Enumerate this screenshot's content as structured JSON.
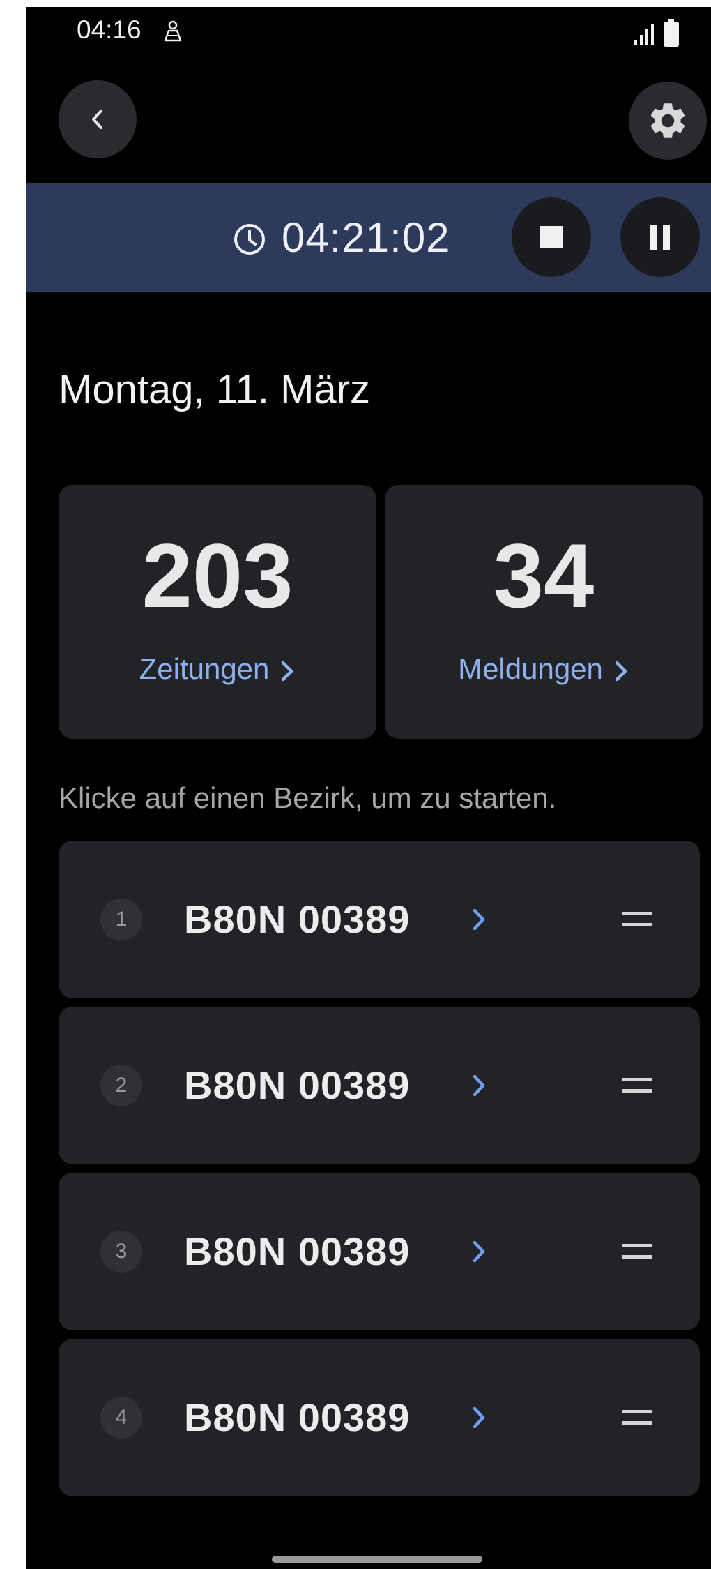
{
  "status_bar": {
    "time": "04:16",
    "location_icon": "map-person-icon",
    "signal_icon": "signal-bars-icon",
    "battery_icon": "battery-icon"
  },
  "nav": {
    "back_icon": "chevron-left-icon",
    "settings_icon": "gear-icon"
  },
  "timer": {
    "clock_icon": "clock-icon",
    "value": "04:21:02",
    "stop_icon": "stop-icon",
    "pause_icon": "pause-icon",
    "bar_color": "#2e3a5c"
  },
  "date_title": "Montag, 11. März",
  "stats": [
    {
      "number": "203",
      "label": "Zeitungen"
    },
    {
      "number": "34",
      "label": "Meldungen"
    }
  ],
  "hint": "Klicke auf einen Bezirk, um zu starten.",
  "districts": [
    {
      "index": "1",
      "label": "B80N 00389"
    },
    {
      "index": "2",
      "label": "B80N 00389"
    },
    {
      "index": "3",
      "label": "B80N 00389"
    },
    {
      "index": "4",
      "label": "B80N 00389"
    }
  ],
  "colors": {
    "accent": "#8fb0f0",
    "chevron": "#6f9ef0",
    "card": "#222326",
    "background": "#000000"
  }
}
